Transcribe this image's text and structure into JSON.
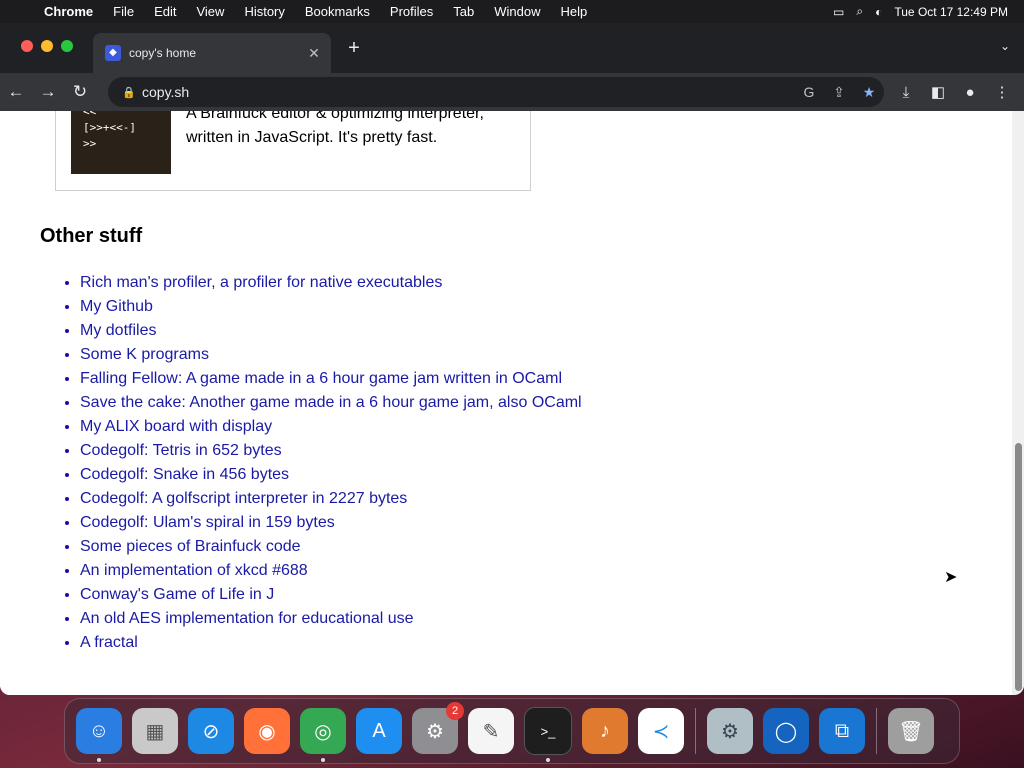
{
  "menubar": {
    "app": "Chrome",
    "items": [
      "File",
      "Edit",
      "View",
      "History",
      "Bookmarks",
      "Profiles",
      "Tab",
      "Window",
      "Help"
    ],
    "clock": "Tue Oct 17  12:49 PM"
  },
  "browser": {
    "tab_title": "copy's home",
    "url": "copy.sh"
  },
  "page": {
    "project": {
      "thumb_code": "<<\n[>>+<<-]\n>>",
      "description": "A Brainfuck editor & optimizing interpreter, written in JavaScript. It's pretty fast."
    },
    "section_heading": "Other stuff",
    "links": [
      "Rich man's profiler, a profiler for native executables",
      "My Github",
      "My dotfiles",
      "Some K programs",
      "Falling Fellow: A game made in a 6 hour game jam written in OCaml",
      "Save the cake: Another game made in a 6 hour game jam, also OCaml",
      "My ALIX board with display",
      "Codegolf: Tetris in 652 bytes",
      "Codegolf: Snake in 456 bytes",
      "Codegolf: A golfscript interpreter in 2227 bytes",
      "Codegolf: Ulam's spiral in 159 bytes",
      "Some pieces of Brainfuck code",
      "An implementation of xkcd #688",
      "Conway's Game of Life in J",
      "An old AES implementation for educational use",
      "A fractal"
    ]
  },
  "dock": {
    "apps": [
      {
        "name": "finder",
        "icon": "finder-icon",
        "color": "#2a7de1"
      },
      {
        "name": "launchpad",
        "icon": "launchpad-icon",
        "color": "#c9c9c9"
      },
      {
        "name": "safari",
        "icon": "safari-icon",
        "color": "#1e88e5"
      },
      {
        "name": "firefox",
        "icon": "firefox-icon",
        "color": "#ff7139"
      },
      {
        "name": "chrome",
        "icon": "chrome-icon",
        "color": "#34a853"
      },
      {
        "name": "app-store",
        "icon": "app-store-icon",
        "color": "#1f8ef1"
      },
      {
        "name": "system-settings",
        "icon": "gear-icon",
        "color": "#8e8e93",
        "badge": "2"
      },
      {
        "name": "textedit",
        "icon": "textedit-icon",
        "color": "#f5f5f5"
      },
      {
        "name": "terminal",
        "icon": "terminal-icon",
        "color": "#1e1e1e"
      },
      {
        "name": "garageband",
        "icon": "guitar-icon",
        "color": "#e07a2e"
      },
      {
        "name": "vscode",
        "icon": "vscode-icon",
        "color": "#ffffff"
      }
    ],
    "extras": [
      {
        "name": "utility",
        "icon": "gear-icon",
        "color": "#b0bec5"
      },
      {
        "name": "browser-app",
        "icon": "globe-icon",
        "color": "#1565c0"
      },
      {
        "name": "remote-app",
        "icon": "remote-icon",
        "color": "#1976d2"
      }
    ],
    "trash": {
      "name": "trash",
      "icon": "trash-icon",
      "color": "#9e9e9e"
    }
  }
}
